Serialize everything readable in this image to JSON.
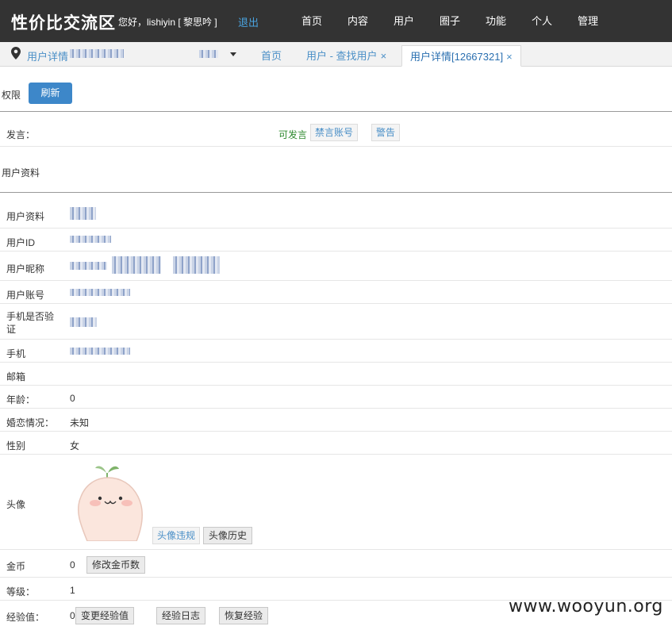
{
  "header": {
    "brand": "性价比交流区",
    "greeting": "您好，lishiyin [ 黎思吟 ]",
    "logout": "退出",
    "nav": [
      "首页",
      "内容",
      "用户",
      "圈子",
      "功能",
      "个人",
      "管理"
    ]
  },
  "tabbar": {
    "location_label": "用户详情",
    "tabs": [
      {
        "label": "首页",
        "closable": false,
        "active": false
      },
      {
        "label": "用户 - 查找用户",
        "close": "×",
        "active": false
      },
      {
        "label": "用户详情[12667321]",
        "close": "×",
        "active": true
      }
    ]
  },
  "permissions": {
    "label": "权限",
    "refresh_button": "刷新"
  },
  "speech": {
    "label": "发言：",
    "status": "可发言",
    "ban_button": "禁言账号",
    "warn_button": "警告"
  },
  "profile_section_title": "用户资料",
  "fields": {
    "profile": "用户资料",
    "user_id": "用户ID",
    "nickname": "用户昵称",
    "account": "用户账号",
    "phone_verified": "手机是否验证",
    "phone": "手机",
    "email": "邮箱",
    "age_label": "年龄：",
    "age_value": "0",
    "marital_label": "婚恋情况：",
    "marital_value": "未知",
    "gender_label": "性别",
    "gender_value": "女",
    "avatar_label": "头像",
    "avatar_violation_button": "头像违规",
    "avatar_history_button": "头像历史",
    "coins_label": "金币",
    "coins_value": "0",
    "coins_button": "修改金币数",
    "level_label": "等级：",
    "level_value": "1",
    "exp_label": "经验值：",
    "exp_value": "0",
    "exp_change_button": "变更经验值",
    "exp_log_button": "经验日志",
    "exp_restore_button": "恢复经验"
  },
  "watermark": "www.wooyun.org",
  "colors": {
    "topbar": "#333333",
    "link": "#4a8fc7",
    "primary_button": "#3d87c9",
    "status_green": "#2f8a2f"
  }
}
